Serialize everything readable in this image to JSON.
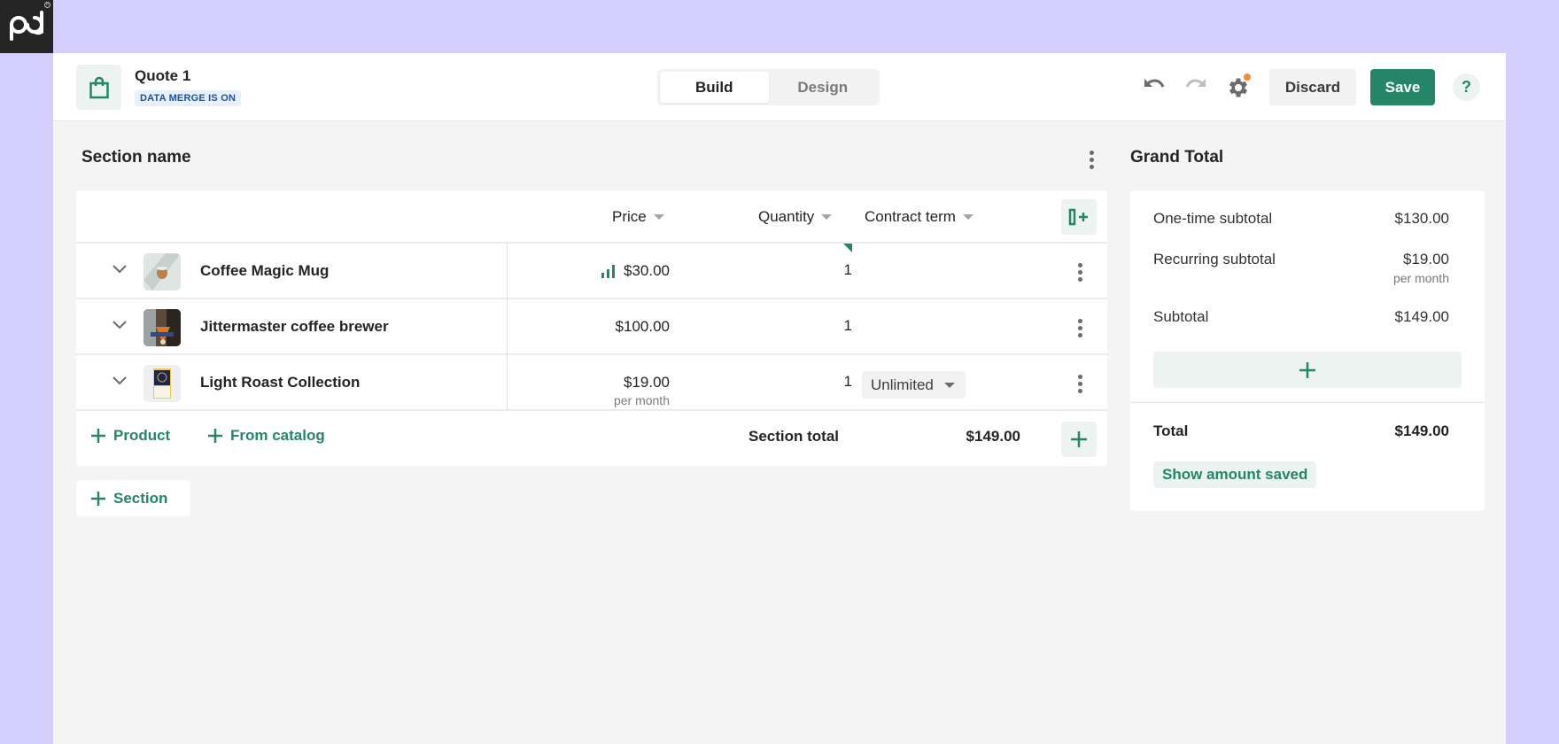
{
  "brand": {
    "logo_text": "pd",
    "accent": "#248567",
    "background": "#d5cffd"
  },
  "header": {
    "doc_title": "Quote 1",
    "merge_badge": "DATA MERGE IS ON",
    "tabs": [
      {
        "label": "Build",
        "active": true
      },
      {
        "label": "Design",
        "active": false
      }
    ],
    "icons": [
      "undo-icon",
      "redo-icon",
      "settings-icon"
    ],
    "settings_has_notification": true,
    "discard_label": "Discard",
    "save_label": "Save",
    "help_label": "?"
  },
  "section": {
    "title": "Section name",
    "columns": [
      {
        "label": "Price"
      },
      {
        "label": "Quantity"
      },
      {
        "label": "Contract term"
      }
    ],
    "rows": [
      {
        "name": "Coffee Magic Mug",
        "price": "$30.00",
        "price_sub": "",
        "qty": "1",
        "term": "",
        "has_tier_icon": true
      },
      {
        "name": "Jittermaster coffee brewer",
        "price": "$100.00",
        "price_sub": "",
        "qty": "1",
        "term": ""
      },
      {
        "name": "Light Roast Collection",
        "price": "$19.00",
        "price_sub": "per month",
        "qty": "1",
        "term": "Unlimited"
      }
    ],
    "add_product_label": "Product",
    "add_catalog_label": "From catalog",
    "total_label": "Section total",
    "total_value": "$149.00"
  },
  "add_section_label": "Section",
  "grand_total": {
    "title": "Grand Total",
    "one_time_label": "One-time subtotal",
    "one_time_value": "$130.00",
    "recurring_label": "Recurring subtotal",
    "recurring_value": "$19.00",
    "recurring_sub": "per month",
    "subtotal_label": "Subtotal",
    "subtotal_value": "$149.00",
    "total_label": "Total",
    "total_value": "$149.00",
    "show_saved_label": "Show amount saved"
  }
}
